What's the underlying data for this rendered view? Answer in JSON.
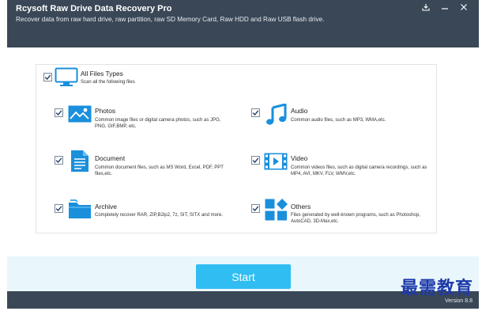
{
  "window": {
    "title": "Rcysoft Raw Drive Data Recovery Pro",
    "subtitle": "Recover data from raw hard drive, raw partition, raw SD Memory Card, Raw HDD and Raw USB flash drive.",
    "controls": [
      "download-icon",
      "minimize-icon",
      "close-icon"
    ]
  },
  "all_files": {
    "title": "All Files Types",
    "description": "Scan all the following files",
    "checked": true,
    "icon": "monitor-icon"
  },
  "file_types": [
    {
      "id": "photos",
      "title": "Photos",
      "description": "Common image files or digital camera photos, such as JPG, PNG, GIF,BMP, etc.",
      "checked": true,
      "icon": "photo-icon"
    },
    {
      "id": "audio",
      "title": "Audio",
      "description": "Common audio files, such as MP3, WMA,etc.",
      "checked": true,
      "icon": "music-note-icon"
    },
    {
      "id": "document",
      "title": "Document",
      "description": "Common document files, such as MS Word, Excel, PDF, PPT files,etc.",
      "checked": true,
      "icon": "document-icon"
    },
    {
      "id": "video",
      "title": "Video",
      "description": "Common videos files, such as digital camera recordings, such as MP4, AVI, MKV, FLV, WMV,etc.",
      "checked": true,
      "icon": "film-icon"
    },
    {
      "id": "archive",
      "title": "Archive",
      "description": "Completely recover RAR, ZIP,B2ip2, 7z, SIT, SITX and more.",
      "checked": true,
      "icon": "folder-icon"
    },
    {
      "id": "others",
      "title": "Others",
      "description": "Files generated by well-known programs, such as Photoshop, AutoCAD, 3D-Max,etc.",
      "checked": true,
      "icon": "grid-diamond-icon"
    }
  ],
  "footer": {
    "start_label": "Start",
    "version": "Version 8.8"
  },
  "watermark": "最需教育",
  "colors": {
    "titlebar": "#3a4756",
    "accent": "#2fbdf2",
    "icon_blue": "#1a8fdc",
    "footer_bg": "#e9f6fc"
  }
}
